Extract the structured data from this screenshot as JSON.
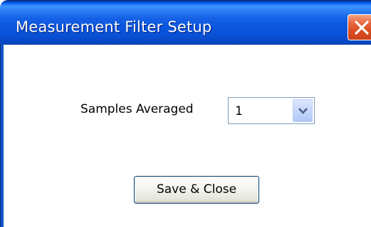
{
  "window": {
    "title": "Measurement Filter Setup",
    "close_icon": "close-icon"
  },
  "filter": {
    "samples_label": "Samples Averaged",
    "samples_value": "1",
    "dropdown_icon": "chevron-down-icon"
  },
  "actions": {
    "save_close_label": "Save & Close"
  },
  "colors": {
    "titlebar": "#0a57df",
    "close_button": "#d94a1d",
    "select_border": "#7f9db9",
    "button_border": "#003c74"
  }
}
